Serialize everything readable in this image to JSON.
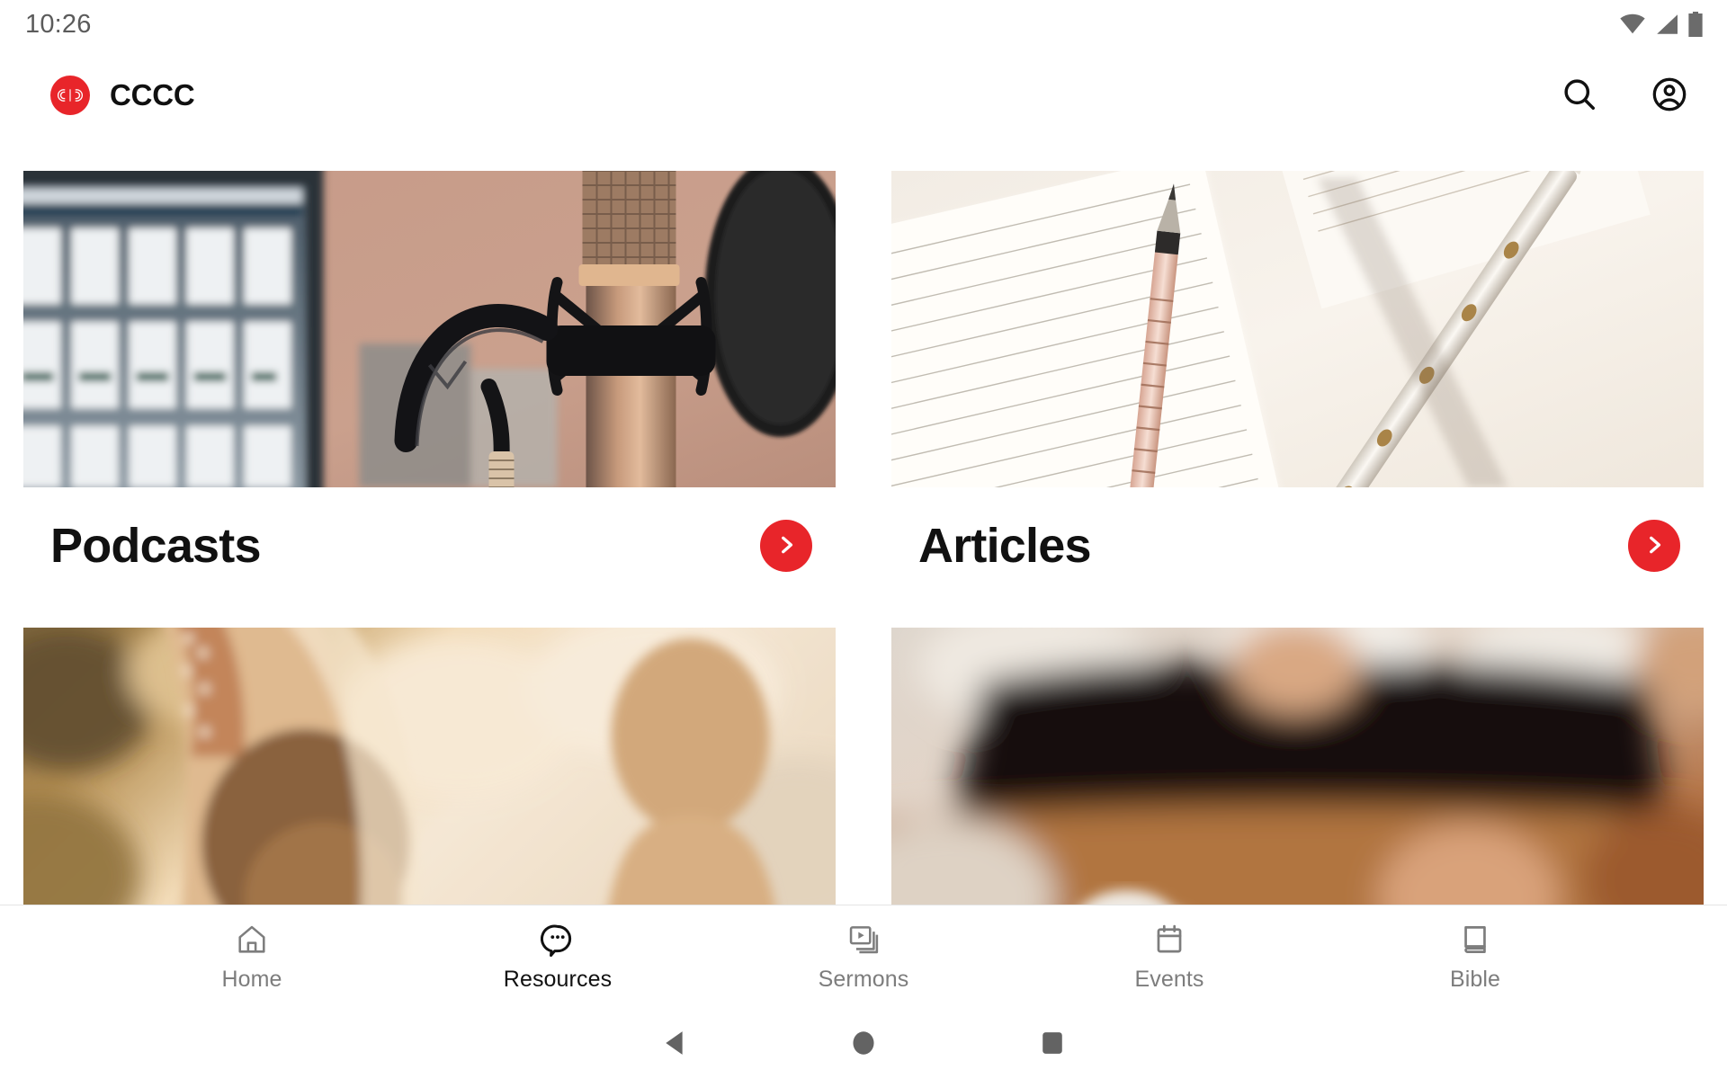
{
  "status_bar": {
    "clock": "10:26",
    "icons": [
      "wifi-icon",
      "cellular-signal-icon",
      "battery-icon"
    ]
  },
  "app_bar": {
    "logo_icon": "cccc-logo-icon",
    "title": "CCCC",
    "actions": [
      {
        "icon": "search-icon",
        "label": "Search"
      },
      {
        "icon": "account-circle-icon",
        "label": "Account"
      }
    ]
  },
  "theme": {
    "accent": "#E8252A",
    "text_primary": "#111111",
    "text_muted": "#7d7d7d",
    "background": "#ffffff"
  },
  "main": {
    "cards": [
      {
        "title": "Podcasts",
        "image": "podcast-microphone-photo",
        "arrow_icon": "chevron-right-icon"
      },
      {
        "title": "Articles",
        "image": "notebook-and-pens-photo",
        "arrow_icon": "chevron-right-icon"
      },
      {
        "title": "",
        "image": "people-at-sunset-photo",
        "arrow_icon": "chevron-right-icon"
      },
      {
        "title": "",
        "image": "blurred-person-with-device-photo",
        "arrow_icon": "chevron-right-icon"
      }
    ]
  },
  "bottom_nav": {
    "active_index": 1,
    "items": [
      {
        "label": "Home",
        "icon": "home-icon"
      },
      {
        "label": "Resources",
        "icon": "chat-bubble-dots-icon"
      },
      {
        "label": "Sermons",
        "icon": "video-library-icon"
      },
      {
        "label": "Events",
        "icon": "calendar-icon"
      },
      {
        "label": "Bible",
        "icon": "book-icon"
      }
    ]
  },
  "system_nav": {
    "buttons": [
      {
        "name": "back-button",
        "icon": "triangle-left-icon"
      },
      {
        "name": "home-button",
        "icon": "circle-icon"
      },
      {
        "name": "recents-button",
        "icon": "square-icon"
      }
    ]
  }
}
